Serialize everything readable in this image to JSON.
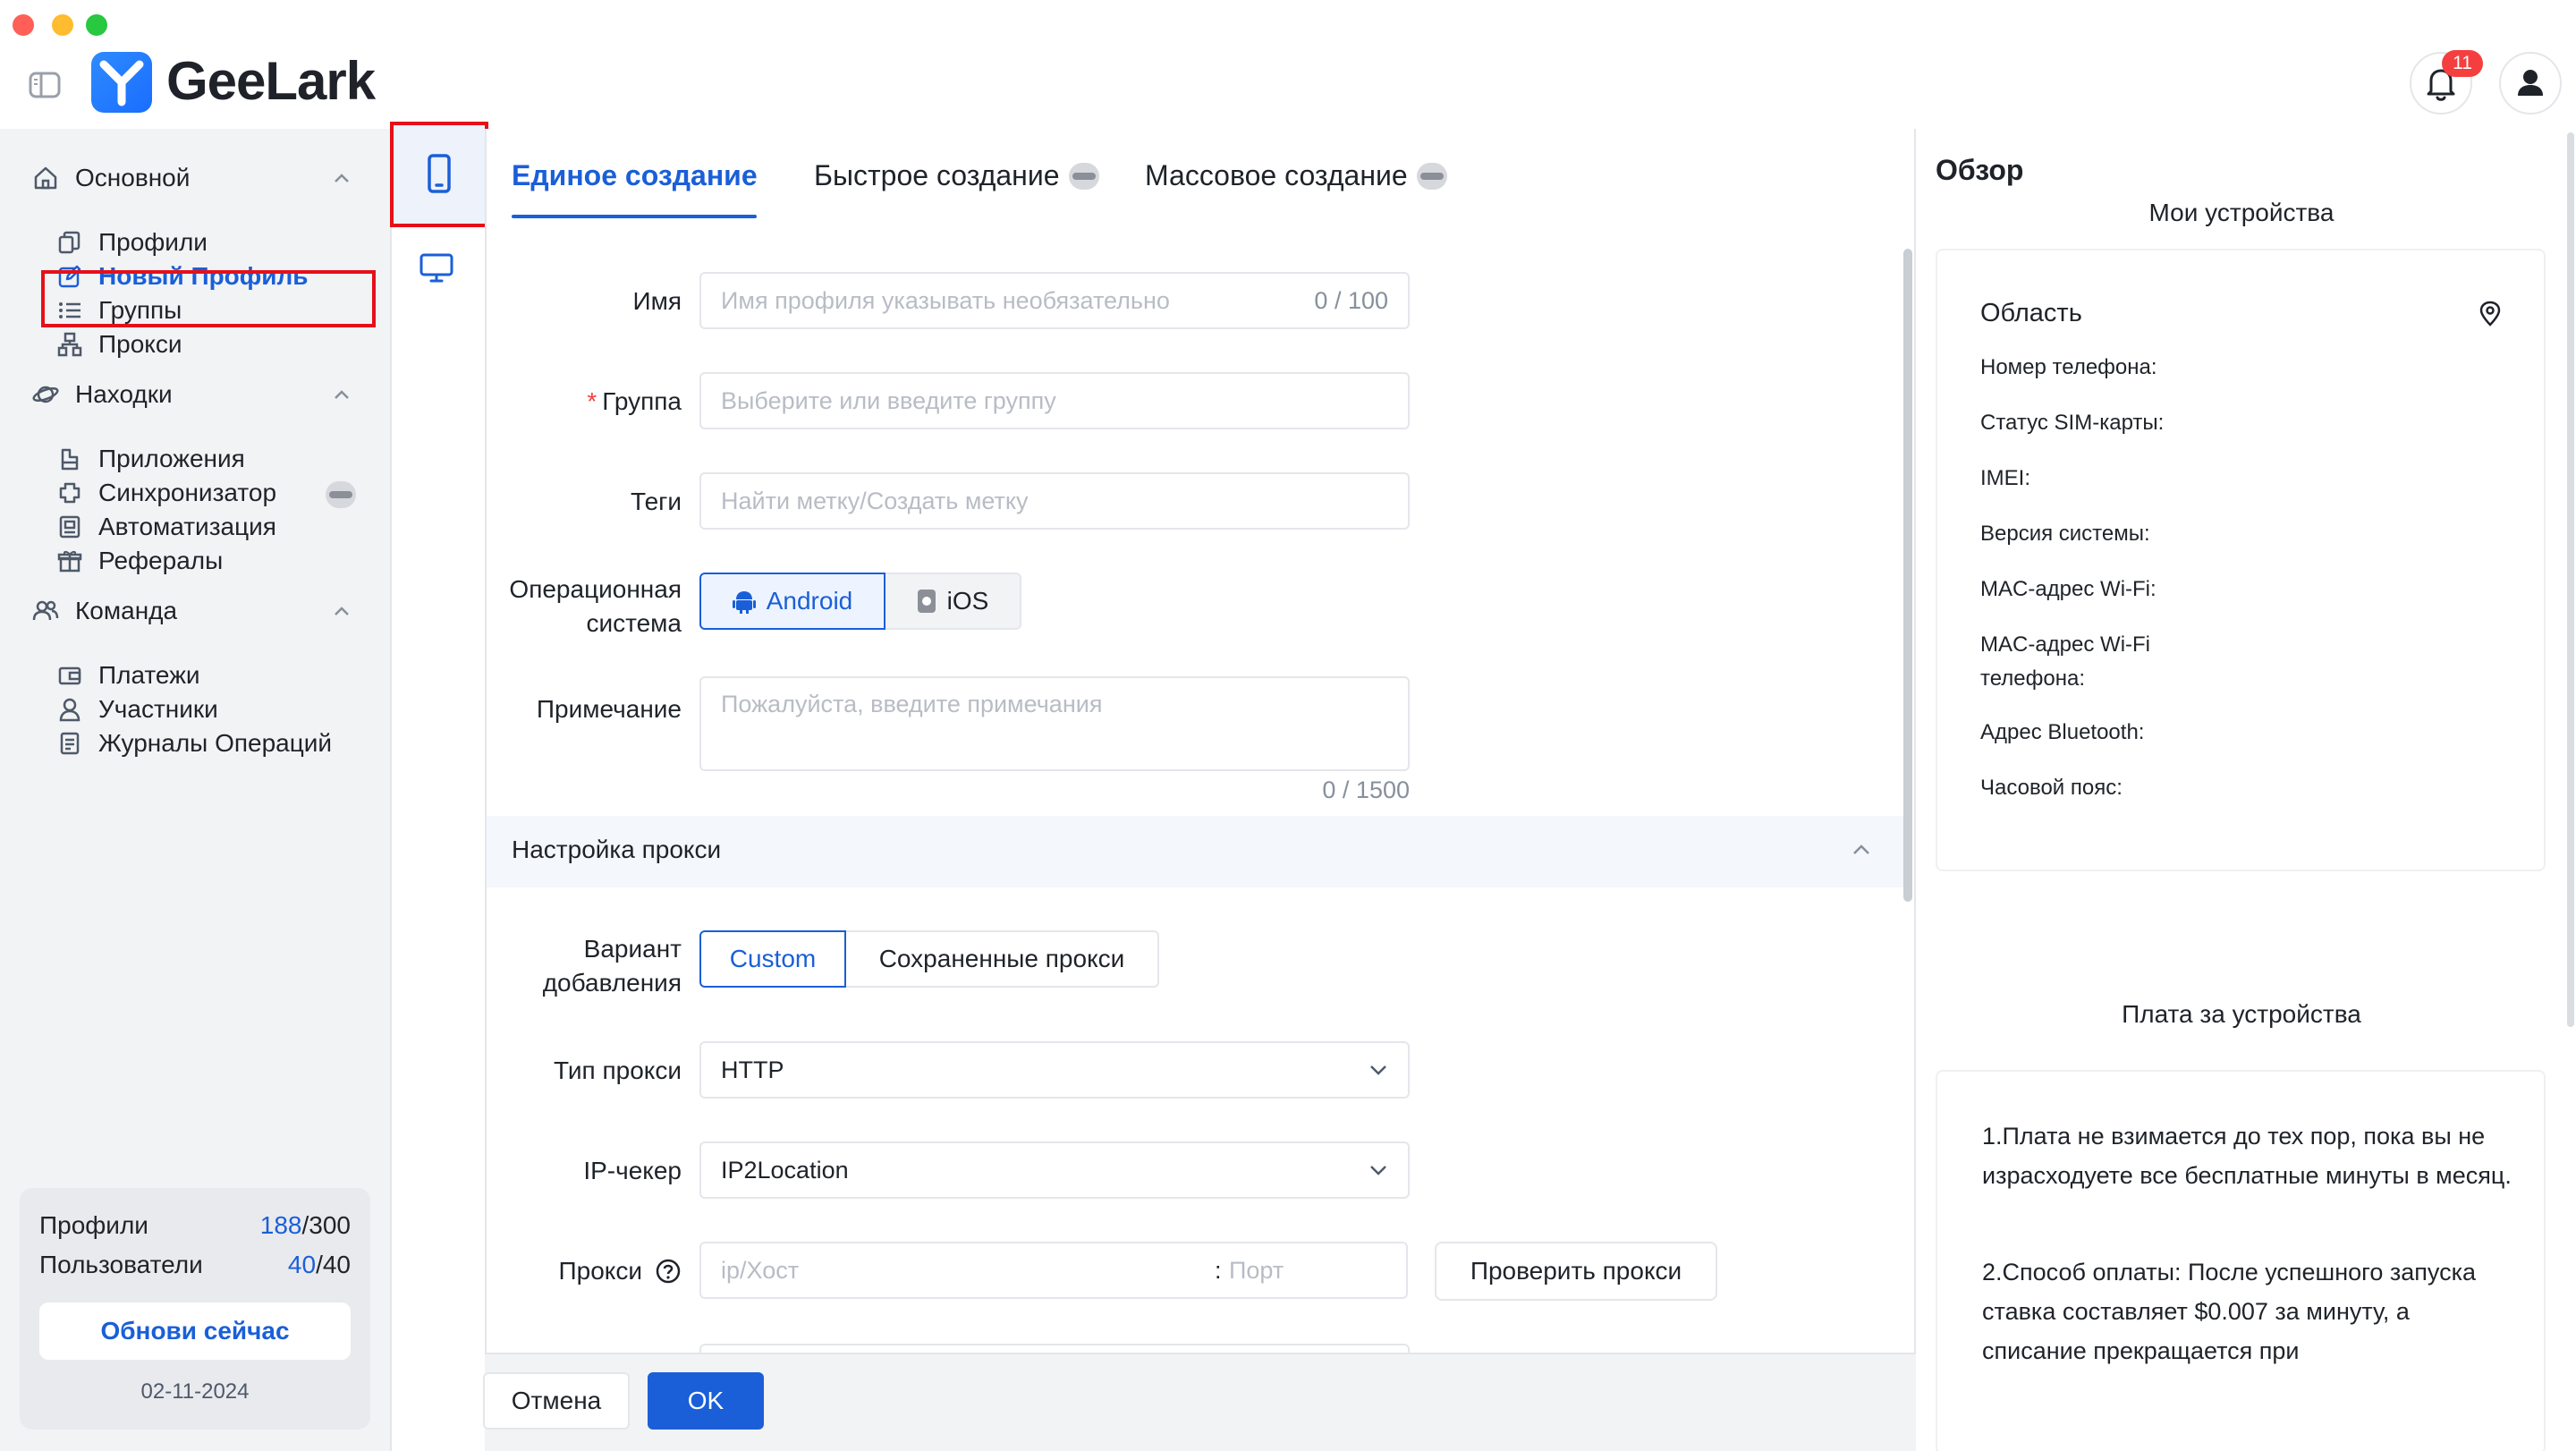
{
  "app": {
    "name": "GeeLark",
    "notifications_count": "11"
  },
  "sidebar": {
    "groups": [
      {
        "label": "Основной",
        "items": [
          "Профили",
          "Новый Профиль",
          "Группы",
          "Прокси"
        ]
      },
      {
        "label": "Находки",
        "items": [
          "Приложения",
          "Синхронизатор",
          "Автоматизация",
          "Рефералы"
        ]
      },
      {
        "label": "Команда",
        "items": [
          "Платежи",
          "Участники",
          "Журналы Операций"
        ]
      }
    ],
    "active_item": "Новый Профиль",
    "usage": {
      "profiles_label": "Профили",
      "profiles_used": "188",
      "profiles_total": "/300",
      "users_label": "Пользователи",
      "users_used": "40",
      "users_total": "/40",
      "update_button": "Обнови сейчас",
      "date": "02-11-2024"
    }
  },
  "tabs": [
    {
      "label": "Единое создание",
      "active": true
    },
    {
      "label": "Быстрое создание",
      "active": false
    },
    {
      "label": "Массовое создание",
      "active": false
    }
  ],
  "form": {
    "name": {
      "label": "Имя",
      "placeholder": "Имя профиля указывать необязательно",
      "counter": "0 / 100"
    },
    "group": {
      "required_mark": "*",
      "label": "Группа",
      "placeholder": "Выберите или введите группу"
    },
    "tags": {
      "label": "Теги",
      "placeholder": "Найти метку/Создать метку"
    },
    "os": {
      "label_line1": "Операционная",
      "label_line2": "система",
      "options": [
        "Android",
        "iOS"
      ],
      "selected": "Android"
    },
    "note": {
      "label": "Примечание",
      "placeholder": "Пожалуйста, введите примечания",
      "counter": "0 / 1500"
    }
  },
  "proxy": {
    "section_title": "Настройка прокси",
    "add_method": {
      "label_line1": "Вариант",
      "label_line2": "добавления",
      "options": [
        "Custom",
        "Сохраненные прокси"
      ],
      "selected": "Custom"
    },
    "type": {
      "label": "Тип прокси",
      "value": "HTTP"
    },
    "ip_checker": {
      "label": "IP-чекер",
      "value": "IP2Location"
    },
    "proxy": {
      "label": "Прокси",
      "host_placeholder": "ip/Хост",
      "separator": ":",
      "port_placeholder": "Порт",
      "check_button": "Проверить прокси"
    }
  },
  "footer": {
    "cancel": "Отмена",
    "ok": "OK"
  },
  "overview": {
    "title": "Обзор",
    "subtitle": "Мои устройства",
    "region_label": "Область",
    "fields": [
      "Номер телефона:",
      "Статус SIM-карты:",
      "IMEI:",
      "Версия системы:",
      "MAC-адрес Wi-Fi:",
      "MAC-адрес Wi-Fi телефона:",
      "Адрес Bluetooth:",
      "Часовой пояс:"
    ],
    "fee_title": "Плата за устройства",
    "fee_paragraphs": [
      "1.Плата не взимается до тех пор, пока вы не израсходуете все бесплатные минуты в месяц.",
      "2.Способ оплаты: После успешного запуска ставка составляет $0.007 за минуту, а списание прекращается при"
    ]
  },
  "colors": {
    "accent": "#1a5fd8",
    "highlight": "#e5101a",
    "badge": "#f53f3f"
  }
}
